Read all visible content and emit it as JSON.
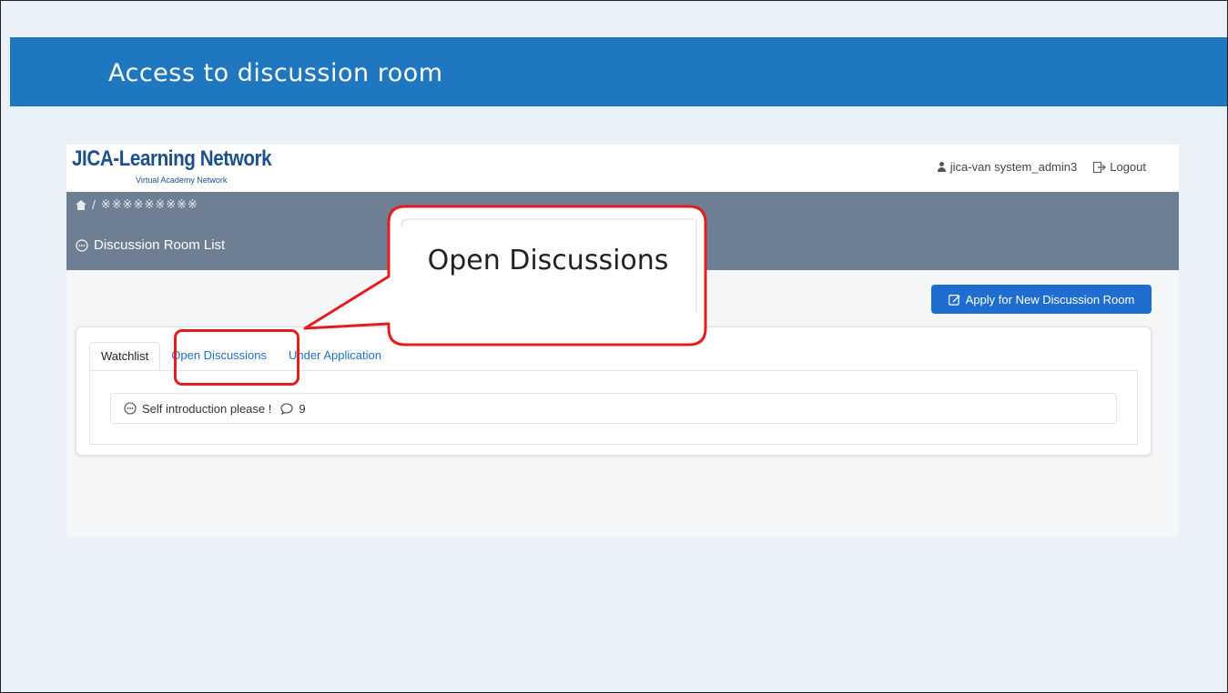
{
  "banner": {
    "title": "Access to discussion room"
  },
  "app": {
    "logo": {
      "main": "JICA-Learning Network",
      "sub": "Virtual Academy Network"
    },
    "header": {
      "user_name": "jica-van system_admin3",
      "logout_label": "Logout"
    },
    "breadcrumb": {
      "separator": "/",
      "current": "※※※※※※※※※"
    },
    "section_title": "Discussion Room List",
    "apply_button_label": "Apply for New Discussion Room",
    "tabs": [
      {
        "label": "Watchlist",
        "active": true
      },
      {
        "label": "Open Discussions",
        "active": false
      },
      {
        "label": "Under Application",
        "active": false
      }
    ],
    "discussions": [
      {
        "title": "Self introduction please !",
        "comment_count": "9"
      }
    ]
  },
  "callout": {
    "text": "Open Discussions"
  },
  "colors": {
    "banner": "#1f77c0",
    "subnav": "#6e7e93",
    "primary_button": "#1f6ecf",
    "highlight": "#e31d1d",
    "slide_background": "#e9f0f7"
  },
  "icons": [
    "user-icon",
    "logout-icon",
    "home-icon",
    "chat-bubble-icon",
    "edit-icon",
    "comment-icon"
  ]
}
